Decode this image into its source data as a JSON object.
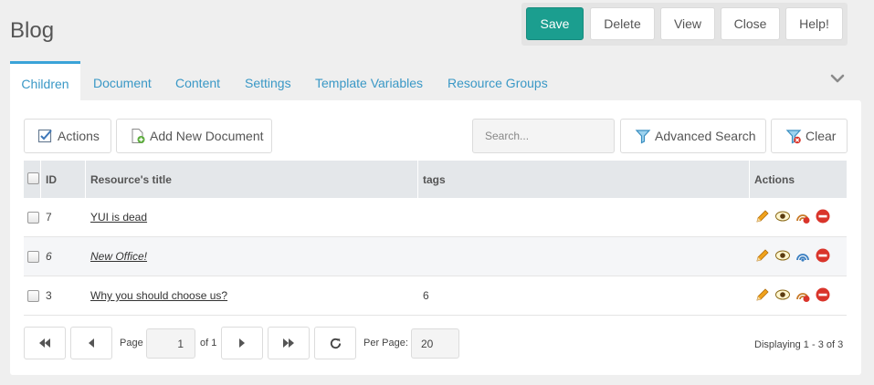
{
  "page": {
    "title": "Blog"
  },
  "toolbar": {
    "save": "Save",
    "delete": "Delete",
    "view": "View",
    "close": "Close",
    "help": "Help!"
  },
  "tabs": [
    {
      "label": "Children",
      "active": true
    },
    {
      "label": "Document"
    },
    {
      "label": "Content"
    },
    {
      "label": "Settings"
    },
    {
      "label": "Template Variables"
    },
    {
      "label": "Resource Groups"
    }
  ],
  "grid_toolbar": {
    "actions": "Actions",
    "add_new": "Add New Document",
    "search_placeholder": "Search...",
    "advanced_search": "Advanced Search",
    "clear": "Clear"
  },
  "columns": {
    "id": "ID",
    "title": "Resource's title",
    "tags": "tags",
    "actions": "Actions"
  },
  "rows": [
    {
      "id": "7",
      "title": "YUI is dead",
      "tags": "",
      "unpublished": false
    },
    {
      "id": "6",
      "title": "New Office!",
      "tags": "",
      "unpublished": true
    },
    {
      "id": "3",
      "title": "Why you should choose us?",
      "tags": "6",
      "unpublished": false
    }
  ],
  "pagination": {
    "page_label": "Page",
    "page_value": "1",
    "of_label": "of 1",
    "per_page_label": "Per Page:",
    "per_page_value": "20",
    "displaying": "Displaying 1 - 3 of 3"
  },
  "colors": {
    "accent": "#1b9e8f",
    "link": "#3a98c6",
    "delete": "#d9352b",
    "edit": "#e89a1c"
  },
  "icons": [
    "checklist-icon",
    "add-document-icon",
    "filter-icon",
    "clear-filter-icon",
    "edit-pencil-icon",
    "view-eye-icon",
    "publish-status-icon",
    "delete-icon",
    "first-page-icon",
    "prev-page-icon",
    "next-page-icon",
    "last-page-icon",
    "refresh-icon",
    "chevron-down-icon"
  ]
}
